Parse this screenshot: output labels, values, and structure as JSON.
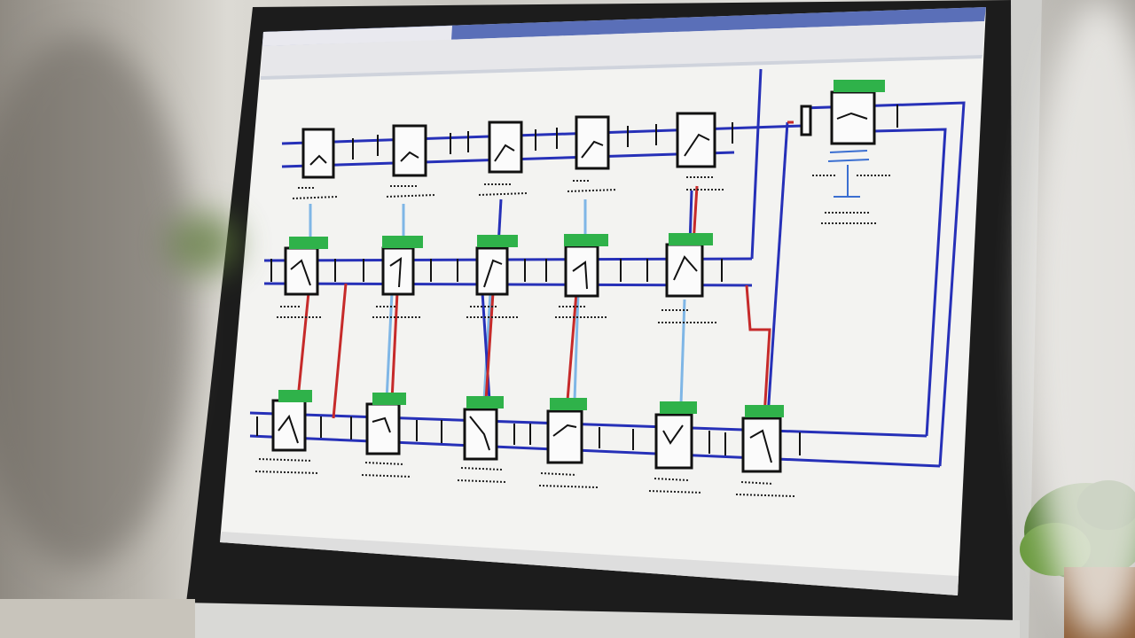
{
  "window": {
    "title": "",
    "menu_label": "",
    "toolbar_label": ""
  },
  "colors": {
    "bezel": "#1c1c1c",
    "screen_bg": "#f3f3f1",
    "titlebar": "#5a6fb8",
    "bus_blue": "#2630b8",
    "line_red": "#c62a2a",
    "line_light_blue": "#7fb6e6",
    "label_green": "#2fb24a",
    "plant_green": "#4f7a2f"
  },
  "diagram": {
    "rows": [
      {
        "name": "row-1",
        "blocks": 5,
        "tags": [
          "",
          "",
          "",
          "",
          ""
        ]
      },
      {
        "name": "row-2",
        "blocks": 5,
        "tags": [
          "",
          "",
          "",
          "",
          ""
        ]
      },
      {
        "name": "row-3",
        "blocks": 6,
        "tags": [
          "",
          "",
          "",
          "",
          "",
          ""
        ]
      }
    ],
    "side_block_tag": "",
    "icons": [
      "switch-block-icon"
    ]
  }
}
